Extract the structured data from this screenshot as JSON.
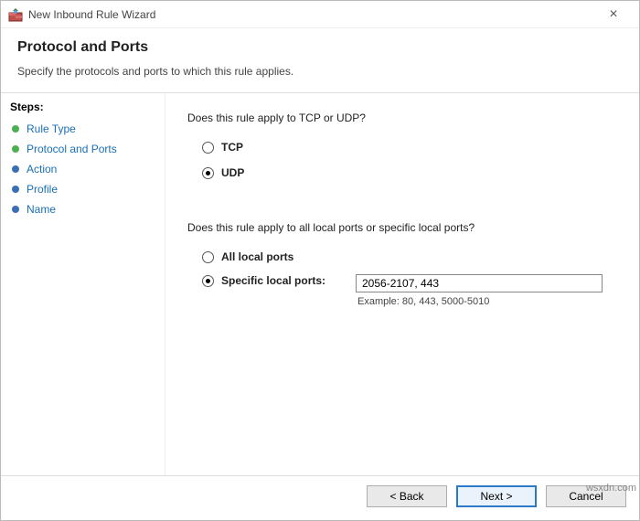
{
  "window": {
    "title": "New Inbound Rule Wizard"
  },
  "header": {
    "title": "Protocol and Ports",
    "subtitle": "Specify the protocols and ports to which this rule applies."
  },
  "sidebar": {
    "label": "Steps:",
    "items": [
      {
        "label": "Rule Type",
        "active": false,
        "bullet": "green"
      },
      {
        "label": "Protocol and Ports",
        "active": true,
        "bullet": "green"
      },
      {
        "label": "Action",
        "active": false,
        "bullet": "blue"
      },
      {
        "label": "Profile",
        "active": false,
        "bullet": "blue"
      },
      {
        "label": "Name",
        "active": false,
        "bullet": "blue"
      }
    ]
  },
  "content": {
    "q_protocol": "Does this rule apply to TCP or UDP?",
    "protocol_tcp": "TCP",
    "protocol_udp": "UDP",
    "protocol_selected": "UDP",
    "q_ports": "Does this rule apply to all local ports or specific local ports?",
    "ports_all": "All local ports",
    "ports_specific": "Specific local ports:",
    "ports_selected": "specific",
    "ports_value": "2056-2107, 443",
    "ports_example": "Example: 80, 443, 5000-5010"
  },
  "footer": {
    "back": "< Back",
    "next": "Next >",
    "cancel": "Cancel"
  },
  "watermark": "wsxdn.com"
}
